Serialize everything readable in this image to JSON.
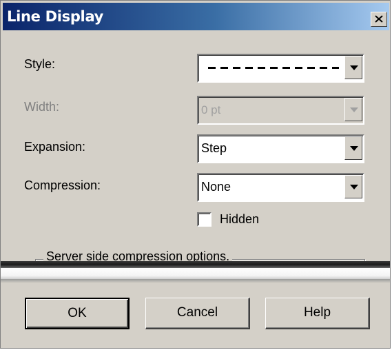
{
  "window": {
    "title": "Line Display"
  },
  "form": {
    "style_label": "Style:",
    "style_value": "dashed-line",
    "width_label": "Width:",
    "width_value": "0 pt",
    "expansion_label": "Expansion:",
    "expansion_value": "Step",
    "compression_label": "Compression:",
    "compression_value": "None",
    "hidden_label": "Hidden",
    "hidden_checked": false
  },
  "groupbox": {
    "legend": "Server side compression options."
  },
  "buttons": {
    "ok": "OK",
    "cancel": "Cancel",
    "help": "Help"
  },
  "icons": {
    "close": "close-icon",
    "dropdown": "chevron-down-icon"
  }
}
